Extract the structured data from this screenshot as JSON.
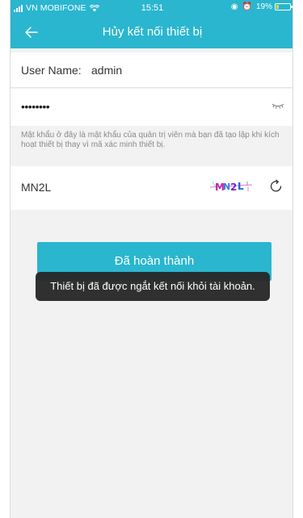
{
  "status_bar": {
    "carrier": "VN MOBIFONE",
    "time": "15:51",
    "battery_pct": "19%",
    "battery_level": 0.19
  },
  "header": {
    "title": "Hủy kết nối thiết bị",
    "back_icon": "arrow-left-icon"
  },
  "form": {
    "username_label": "User Name:",
    "username_value": "admin",
    "password_mask": "••••••••",
    "password_hint": "Mật khẩu ở đây là mật khẩu của quản trị viên mà bạn đã tạo lập khi kích hoạt thiết bị thay vì mã xác minh thiết bị.",
    "captcha_input": "MN2L",
    "captcha_image_text": "MN2L"
  },
  "done_button": "Đã hoàn thành",
  "toast": "Thiết bị đã được ngắt kết nối khỏi tài khoản.",
  "colors": {
    "accent": "#2ab6cf",
    "background": "#f2f2f2",
    "toast_bg": "#282828"
  }
}
